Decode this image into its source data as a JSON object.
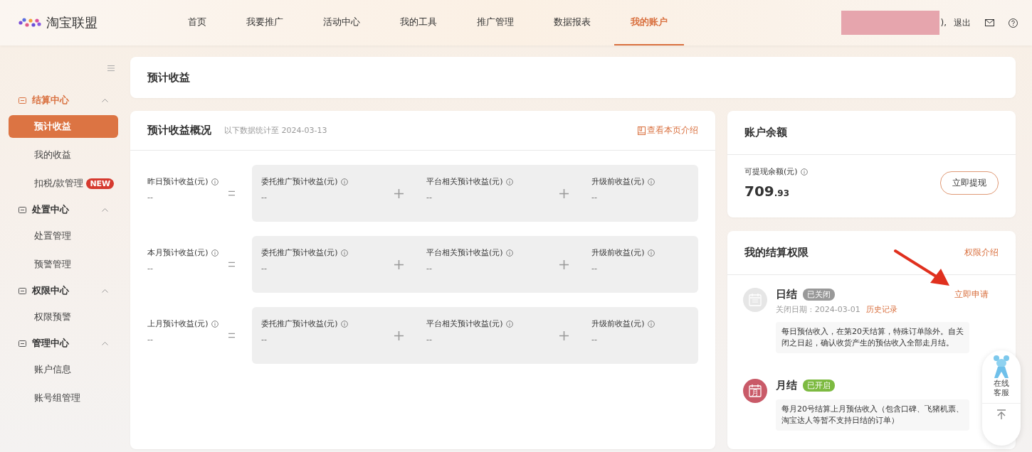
{
  "header": {
    "logo": "淘宝联盟",
    "nav": [
      {
        "label": "首页",
        "selected": false
      },
      {
        "label": "我要推广",
        "selected": false
      },
      {
        "label": "活动中心",
        "selected": false
      },
      {
        "label": "我的工具",
        "selected": false
      },
      {
        "label": "推广管理",
        "selected": false
      },
      {
        "label": "数据报表",
        "selected": false
      },
      {
        "label": "我的账户",
        "selected": true
      }
    ],
    "user_suffix": "),",
    "logout": "退出"
  },
  "sidebar": {
    "groups": [
      {
        "label": "结算中心",
        "expanded": true,
        "items": [
          {
            "label": "预计收益",
            "selected": true
          },
          {
            "label": "我的收益",
            "selected": false
          },
          {
            "label": "扣税/款管理",
            "selected": false,
            "badge": "NEW"
          }
        ]
      },
      {
        "label": "处置中心",
        "expanded": true,
        "items": [
          {
            "label": "处置管理",
            "selected": false
          },
          {
            "label": "预警管理",
            "selected": false
          }
        ]
      },
      {
        "label": "权限中心",
        "expanded": true,
        "items": [
          {
            "label": "权限预警",
            "selected": false
          }
        ]
      },
      {
        "label": "管理中心",
        "expanded": true,
        "items": [
          {
            "label": "账户信息",
            "selected": false
          },
          {
            "label": "账号组管理",
            "selected": false
          }
        ]
      }
    ]
  },
  "page_title": "预计收益",
  "overview": {
    "title": "预计收益概况",
    "subtitle": "以下数据统计至 2024-03-13",
    "intro_link": "查看本页介绍",
    "rows": [
      {
        "label": "昨日预计收益(元)",
        "value": "--",
        "terms": [
          {
            "label": "委托推广预计收益(元)",
            "value": "--"
          },
          {
            "label": "平台相关预计收益(元)",
            "value": "--"
          },
          {
            "label": "升级前收益(元)",
            "value": "--"
          }
        ]
      },
      {
        "label": "本月预计收益(元)",
        "value": "--",
        "terms": [
          {
            "label": "委托推广预计收益(元)",
            "value": "--"
          },
          {
            "label": "平台相关预计收益(元)",
            "value": "--"
          },
          {
            "label": "升级前收益(元)",
            "value": "--"
          }
        ]
      },
      {
        "label": "上月预计收益(元)",
        "value": "--",
        "terms": [
          {
            "label": "委托推广预计收益(元)",
            "value": "--"
          },
          {
            "label": "平台相关预计收益(元)",
            "value": "--"
          },
          {
            "label": "升级前收益(元)",
            "value": "--"
          }
        ]
      }
    ]
  },
  "balance": {
    "title": "账户余额",
    "label": "可提现余额(元)",
    "amount_int": "709",
    "amount_dec": ".93",
    "button": "立即提现"
  },
  "settlement": {
    "title": "我的结算权限",
    "link": "权限介绍",
    "items": [
      {
        "name": "日结",
        "status": "已关闭",
        "on": false,
        "apply_link": "立即申请",
        "date_text": "关闭日期 : 2024-03-01",
        "history_link": "历史记录",
        "description": "每日预估收入，在第20天结算，特殊订单除外。自关闭之日起，确认收货产生的预估收入全部走月结。"
      },
      {
        "name": "月结",
        "status": "已开启",
        "on": true,
        "icon_text": "月",
        "description": "每月20号结算上月预估收入（包含口碑、飞猪机票、淘宝达人等暂不支持日结的订单）"
      }
    ]
  },
  "float_widget": {
    "label": "在线客服"
  }
}
